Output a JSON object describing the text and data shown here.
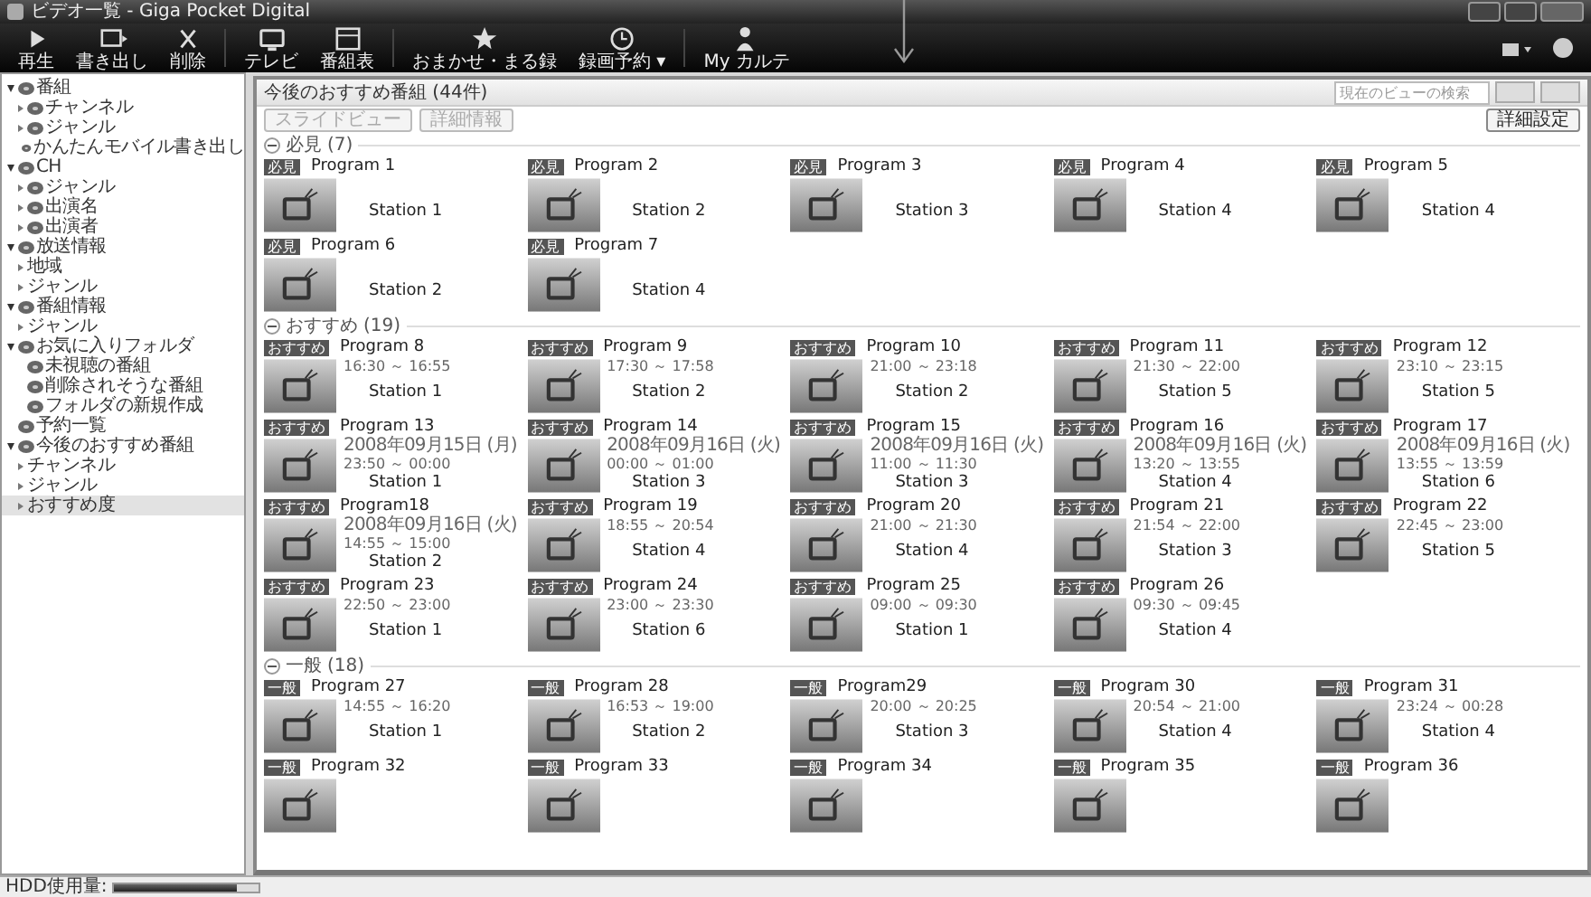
{
  "window": {
    "title": "ビデオ一覧 - Giga Pocket Digital"
  },
  "toolbar": [
    {
      "kind": "play",
      "label": "再生"
    },
    {
      "kind": "export",
      "label": "書き出し"
    },
    {
      "kind": "delete",
      "label": "削除"
    },
    {
      "kind": "tv",
      "label": "テレビ"
    },
    {
      "kind": "guide",
      "label": "番組表"
    },
    {
      "kind": "star",
      "label": "おまかせ・まる録"
    },
    {
      "kind": "clock",
      "label": "録画予約 ▾"
    },
    {
      "kind": "person",
      "label": "My カルテ"
    }
  ],
  "sidebar": {
    "items": [
      {
        "kind": "folder",
        "label": "番組",
        "expanded": true,
        "selected": false,
        "children": [
          {
            "kind": "folder",
            "label": "チャンネル",
            "expanded": false,
            "selected": false
          },
          {
            "kind": "folder",
            "label": "ジャンル",
            "expanded": false,
            "selected": false
          },
          {
            "kind": "leaf",
            "label": "かんたんモバイル書き出し",
            "selected": false
          }
        ]
      },
      {
        "kind": "folder",
        "label": "CH",
        "expanded": true,
        "selected": false,
        "children": [
          {
            "kind": "folder",
            "label": "ジャンル",
            "expanded": false,
            "selected": false
          },
          {
            "kind": "folder",
            "label": "出演名",
            "expanded": false,
            "selected": false
          },
          {
            "kind": "folder",
            "label": "出演者",
            "expanded": false,
            "selected": false
          }
        ]
      },
      {
        "kind": "folder",
        "label": "放送情報",
        "expanded": true,
        "selected": false,
        "children": [
          {
            "kind": "group",
            "label": "地域",
            "expanded": false,
            "selected": false
          },
          {
            "kind": "group",
            "label": "ジャンル",
            "expanded": false,
            "selected": false
          }
        ]
      },
      {
        "kind": "folder",
        "label": "番組情報",
        "expanded": true,
        "selected": false,
        "children": [
          {
            "kind": "group",
            "label": "ジャンル",
            "expanded": false,
            "selected": false
          }
        ]
      },
      {
        "kind": "folder",
        "label": "お気に入りフォルダ",
        "expanded": true,
        "selected": false,
        "children": [
          {
            "kind": "leaf",
            "label": "未視聴の番組",
            "selected": false
          },
          {
            "kind": "leaf",
            "label": "削除されそうな番組",
            "selected": false
          },
          {
            "kind": "leaf",
            "label": "フォルダの新規作成",
            "selected": false
          }
        ]
      },
      {
        "kind": "leaf",
        "label": "予約一覧",
        "selected": false
      },
      {
        "kind": "folder",
        "label": "今後のおすすめ番組",
        "expanded": true,
        "selected": false,
        "children": [
          {
            "kind": "group",
            "label": "チャンネル",
            "expanded": false,
            "selected": false
          },
          {
            "kind": "group",
            "label": "ジャンル",
            "expanded": false,
            "selected": false
          },
          {
            "kind": "group",
            "label": "おすすめ度",
            "expanded": false,
            "selected": true
          }
        ]
      }
    ]
  },
  "view": {
    "title": "今後のおすすめ番組 (44件)",
    "search": {
      "placeholder": "現在のビューの検索"
    },
    "buttons": [
      {
        "label": "スライドビュー",
        "disabled": true
      },
      {
        "label": "詳細情報",
        "disabled": true
      }
    ],
    "settings_button": "詳細設定",
    "sections": [
      {
        "title": "必見",
        "count": "(7)",
        "expanded": true,
        "programs": [
          {
            "badge": "必見",
            "name": "Program 1",
            "station": "Station 1"
          },
          {
            "badge": "必見",
            "name": "Program 2",
            "station": "Station 2"
          },
          {
            "badge": "必見",
            "name": "Program 3",
            "station": "Station 3"
          },
          {
            "badge": "必見",
            "name": "Program 4",
            "station": "Station 4"
          },
          {
            "badge": "必見",
            "name": "Program 5",
            "station": "Station 4"
          },
          {
            "badge": "必見",
            "name": "Program 6",
            "station": "Station 2"
          },
          {
            "badge": "必見",
            "name": "Program 7",
            "station": "Station 4"
          }
        ]
      },
      {
        "title": "おすすめ",
        "count": "(19)",
        "expanded": true,
        "programs": [
          {
            "badge": "おすすめ",
            "name": "Program 8",
            "time": "16:30 ～ 16:55",
            "station": "Station 1"
          },
          {
            "badge": "おすすめ",
            "name": "Program 9",
            "time": "17:30 ～ 17:58",
            "station": "Station 2"
          },
          {
            "badge": "おすすめ",
            "name": "Program 10",
            "time": "21:00 ～ 23:18",
            "station": "Station 2"
          },
          {
            "badge": "おすすめ",
            "name": "Program 11",
            "time": "21:30 ～ 22:00",
            "station": "Station 5"
          },
          {
            "badge": "おすすめ",
            "name": "Program 12",
            "time": "23:10 ～ 23:15",
            "station": "Station 5"
          },
          {
            "badge": "おすすめ",
            "name": "Program 13",
            "date": "2008年09月15日 (月)",
            "time": "23:50 ～ 00:00",
            "station": "Station 1"
          },
          {
            "badge": "おすすめ",
            "name": "Program 14",
            "date": "2008年09月16日 (火)",
            "time": "00:00 ～ 01:00",
            "station": "Station 3"
          },
          {
            "badge": "おすすめ",
            "name": "Program 15",
            "date": "2008年09月16日 (火)",
            "time": "11:00 ～ 11:30",
            "station": "Station 3"
          },
          {
            "badge": "おすすめ",
            "name": "Program 16",
            "date": "2008年09月16日 (火)",
            "time": "13:20 ～ 13:55",
            "station": "Station 4"
          },
          {
            "badge": "おすすめ",
            "name": "Program 17",
            "date": "2008年09月16日 (火)",
            "time": "13:55 ～ 13:59",
            "station": "Station 6"
          },
          {
            "badge": "おすすめ",
            "name": "Program18",
            "date": "2008年09月16日 (火)",
            "time": "14:55 ～ 15:00",
            "station": "Station 2"
          },
          {
            "badge": "おすすめ",
            "name": "Program 19",
            "time": "18:55 ～ 20:54",
            "station": "Station 4"
          },
          {
            "badge": "おすすめ",
            "name": "Program 20",
            "time": "21:00 ～ 21:30",
            "station": "Station 4"
          },
          {
            "badge": "おすすめ",
            "name": "Program 21",
            "time": "21:54 ～ 22:00",
            "station": "Station 3"
          },
          {
            "badge": "おすすめ",
            "name": "Program 22",
            "time": "22:45 ～ 23:00",
            "station": "Station 5"
          },
          {
            "badge": "おすすめ",
            "name": "Program 23",
            "time": "22:50 ～ 23:00",
            "station": "Station 1"
          },
          {
            "badge": "おすすめ",
            "name": "Program 24",
            "time": "23:00 ～ 23:30",
            "station": "Station 6"
          },
          {
            "badge": "おすすめ",
            "name": "Program 25",
            "time": "09:00 ～ 09:30",
            "station": "Station 1"
          },
          {
            "badge": "おすすめ",
            "name": "Program 26",
            "time": "09:30 ～ 09:45",
            "station": "Station 4"
          }
        ]
      },
      {
        "title": "一般",
        "count": "(18)",
        "expanded": true,
        "programs": [
          {
            "badge": "一般",
            "name": "Program 27",
            "time": "14:55 ～ 16:20",
            "station": "Station 1"
          },
          {
            "badge": "一般",
            "name": "Program 28",
            "time": "16:53 ～ 19:00",
            "station": "Station 2"
          },
          {
            "badge": "一般",
            "name": "Program29",
            "time": "20:00 ～ 20:25",
            "station": "Station 3"
          },
          {
            "badge": "一般",
            "name": "Program 30",
            "time": "20:54 ～ 21:00",
            "station": "Station 4"
          },
          {
            "badge": "一般",
            "name": "Program 31",
            "time": "23:24 ～ 00:28",
            "station": "Station 4"
          },
          {
            "badge": "一般",
            "name": "Program 32"
          },
          {
            "badge": "一般",
            "name": "Program 33"
          },
          {
            "badge": "一般",
            "name": "Program 34"
          },
          {
            "badge": "一般",
            "name": "Program 35"
          },
          {
            "badge": "一般",
            "name": "Program 36"
          }
        ]
      }
    ]
  },
  "status_bar": {
    "label": "HDD使用量:",
    "level": 0.85
  }
}
